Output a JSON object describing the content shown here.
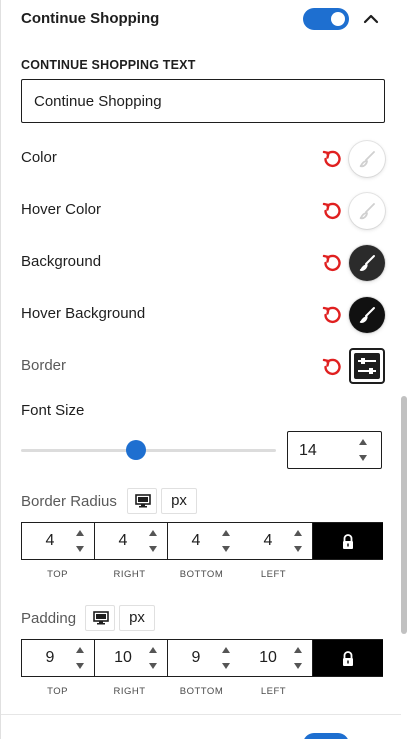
{
  "section": {
    "title": "Continue Shopping",
    "enabled": true,
    "accent_color": "#1e6fd0"
  },
  "text_field": {
    "label": "CONTINUE SHOPPING TEXT",
    "value": "Continue Shopping"
  },
  "colors": [
    {
      "label": "Color",
      "swatch": "#ffffff"
    },
    {
      "label": "Hover Color",
      "swatch": "#ffffff"
    },
    {
      "label": "Background",
      "swatch": "#2b2b2b"
    },
    {
      "label": "Hover Background",
      "swatch": "#111111"
    }
  ],
  "border": {
    "label": "Border"
  },
  "font_size": {
    "label": "Font Size",
    "value": "14",
    "slider_fraction": 0.45
  },
  "border_radius": {
    "label": "Border Radius",
    "unit": "px",
    "top": "4",
    "right": "4",
    "bottom": "4",
    "left": "4"
  },
  "padding": {
    "label": "Padding",
    "unit": "px",
    "top": "9",
    "right": "10",
    "bottom": "9",
    "left": "10"
  },
  "captions": {
    "top": "TOP",
    "right": "RIGHT",
    "bottom": "BOTTOM",
    "left": "LEFT"
  },
  "reset_color": "#e02020"
}
